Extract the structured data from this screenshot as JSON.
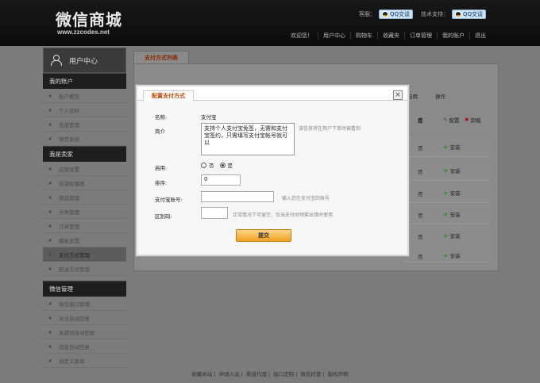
{
  "header": {
    "logo_main": "微信商城",
    "logo_sub": "www.zzcodes.net",
    "contacts": [
      {
        "label": "客服：",
        "button": "QQ交谈"
      },
      {
        "label": "技术支持：",
        "button": "QQ交谈"
      }
    ],
    "nav": [
      "欢迎您！",
      "用户中心",
      "购物车",
      "收藏夹",
      "订单管理",
      "我的账户",
      "退出"
    ]
  },
  "sidebar": {
    "user_center": "用户中心",
    "sections": [
      {
        "title": "我的账户",
        "items": [
          "账户概览",
          "个人资料",
          "充值管理",
          "绑定系统"
        ]
      },
      {
        "title": "我是卖家",
        "items": [
          "店铺设置",
          "店铺轮播图",
          "商品管理",
          "分类管理",
          "订单管理",
          "模板设置",
          "支付方式管理",
          "配送方式管理"
        ]
      },
      {
        "title": "微信管理",
        "items": [
          "微信接口管理",
          "关注自动回复",
          "关键词自动回复",
          "消息自动回复",
          "自定义菜单"
        ]
      }
    ],
    "active_item": "支付方式管理"
  },
  "main": {
    "tab": "支付方式列表",
    "col_enabled": "启用",
    "col_action": "操作",
    "first_row": {
      "enabled": "是",
      "config": "配置",
      "uninstall": "卸载"
    },
    "rows": [
      {
        "enabled": "否",
        "action": "安装"
      },
      {
        "enabled": "否",
        "action": "安装"
      },
      {
        "enabled": "否",
        "action": "安装"
      },
      {
        "enabled": "否",
        "action": "安装"
      },
      {
        "enabled": "否",
        "action": "安装"
      },
      {
        "enabled": "否",
        "action": "安装"
      }
    ]
  },
  "footer": [
    "收藏本站",
    "申请入驻",
    "渠道代理",
    "接口定制",
    "微信托管",
    "版权声明"
  ],
  "modal": {
    "tab": "配置支付方式",
    "close": "×",
    "name_label": "名称:",
    "name_value": "支付宝",
    "intro_label": "简介",
    "intro_value": "支持个人支付宝免签，无需和支付宝签约，只需填写支付宝帐号就可以",
    "intro_hint": "该信息将在用户下单时被看到",
    "enable_label": "启用:",
    "enable_no": "否",
    "enable_yes": "是",
    "sort_label": "排序:",
    "sort_value": "0",
    "account_label": "支付宝账号:",
    "account_hint": "输入您在支付宝的账号",
    "code_label": "区别码:",
    "code_hint": "正常情况下可留空，仅当支付时频繁出错时使用",
    "submit": "提交"
  }
}
